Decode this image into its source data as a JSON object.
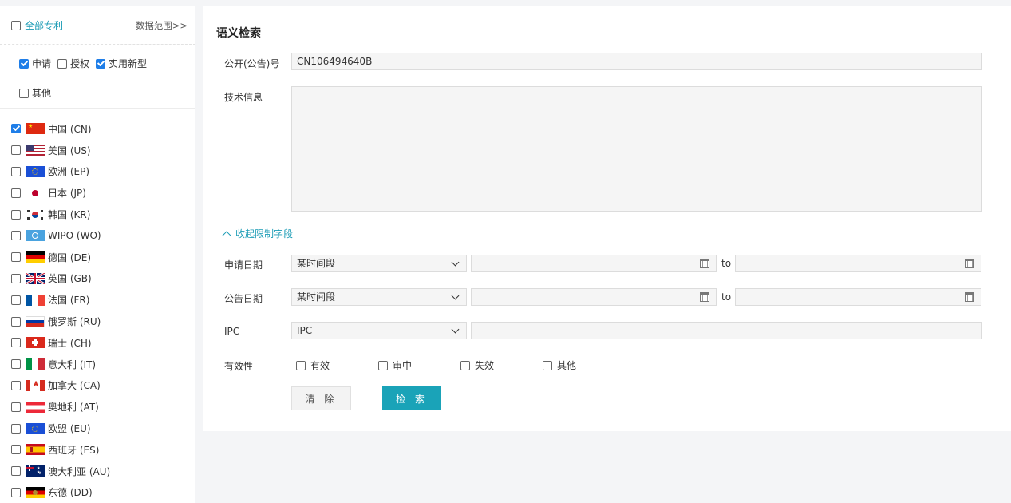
{
  "sidebar": {
    "all_patents_label": "全部专利",
    "data_range_link": "数据范围>>",
    "types": [
      {
        "label": "申请",
        "checked": true
      },
      {
        "label": "授权",
        "checked": false
      },
      {
        "label": "实用新型",
        "checked": true
      },
      {
        "label": "其他",
        "checked": false
      }
    ],
    "countries": [
      {
        "label": "中国 (CN)",
        "checked": true,
        "flag": "cn-flag-icon"
      },
      {
        "label": "美国 (US)",
        "checked": false,
        "flag": "us-flag-icon"
      },
      {
        "label": "欧洲 (EP)",
        "checked": false,
        "flag": "ep-flag-icon"
      },
      {
        "label": "日本 (JP)",
        "checked": false,
        "flag": "jp-flag-icon"
      },
      {
        "label": "韩国 (KR)",
        "checked": false,
        "flag": "kr-flag-icon"
      },
      {
        "label": "WIPO (WO)",
        "checked": false,
        "flag": "wo-flag-icon"
      },
      {
        "label": "德国 (DE)",
        "checked": false,
        "flag": "de-flag-icon"
      },
      {
        "label": "英国 (GB)",
        "checked": false,
        "flag": "gb-flag-icon"
      },
      {
        "label": "法国 (FR)",
        "checked": false,
        "flag": "fr-flag-icon"
      },
      {
        "label": "俄罗斯 (RU)",
        "checked": false,
        "flag": "ru-flag-icon"
      },
      {
        "label": "瑞士 (CH)",
        "checked": false,
        "flag": "ch-flag-icon"
      },
      {
        "label": "意大利 (IT)",
        "checked": false,
        "flag": "it-flag-icon"
      },
      {
        "label": "加拿大 (CA)",
        "checked": false,
        "flag": "ca-flag-icon"
      },
      {
        "label": "奥地利 (AT)",
        "checked": false,
        "flag": "at-flag-icon"
      },
      {
        "label": "欧盟 (EU)",
        "checked": false,
        "flag": "eu-flag-icon"
      },
      {
        "label": "西班牙 (ES)",
        "checked": false,
        "flag": "es-flag-icon"
      },
      {
        "label": "澳大利亚 (AU)",
        "checked": false,
        "flag": "au-flag-icon"
      },
      {
        "label": "东德 (DD)",
        "checked": false,
        "flag": "dd-flag-icon"
      }
    ]
  },
  "main": {
    "title": "语义检索",
    "pub_number_label": "公开(公告)号",
    "pub_number_value": "CN106494640B",
    "tech_info_label": "技术信息",
    "tech_info_value": "",
    "collapse_label": "收起限制字段",
    "app_date_label": "申请日期",
    "app_date_mode": "某时间段",
    "pub_date_label": "公告日期",
    "pub_date_mode": "某时间段",
    "to_label": "to",
    "ipc_label": "IPC",
    "ipc_mode": "IPC",
    "validity_label": "有效性",
    "validity_options": [
      "有效",
      "审中",
      "失效",
      "其他"
    ],
    "clear_button": "清 除",
    "search_button": "检 索"
  },
  "colors": {
    "accent": "#1aa3b8",
    "link": "#1a9bb5",
    "checkbox_checked": "#1f7ee8"
  }
}
